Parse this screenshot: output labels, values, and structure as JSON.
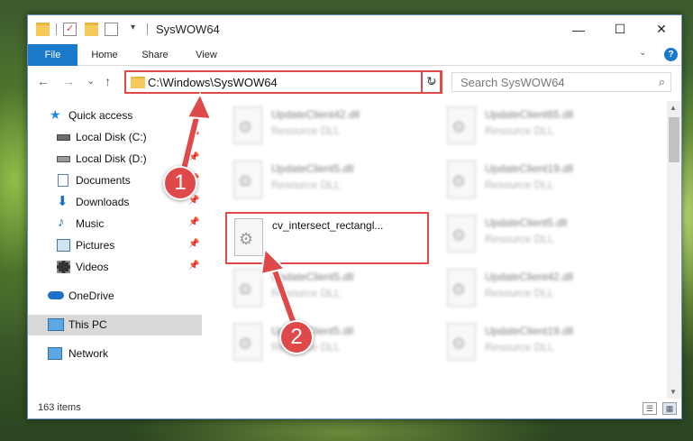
{
  "window": {
    "title": "SysWOW64",
    "minimize": "—",
    "maximize": "☐",
    "close": "✕"
  },
  "ribbon": {
    "tabs": [
      "File",
      "Home",
      "Share",
      "View"
    ],
    "help": "?"
  },
  "nav": {
    "back": "←",
    "forward": "→",
    "recent": "⌄",
    "up": "↑",
    "address": "C:\\Windows\\SysWOW64",
    "search_placeholder": "Search SysWOW64"
  },
  "sidebar": {
    "items": [
      {
        "label": "Quick access",
        "icon": "star-icon",
        "color": "#1e88e5"
      },
      {
        "label": "Local Disk (C:)",
        "icon": "drive-icon",
        "pinned": true
      },
      {
        "label": "Local Disk (D:)",
        "icon": "drive-icon",
        "pinned": true
      },
      {
        "label": "Documents",
        "icon": "document-icon",
        "pinned": true
      },
      {
        "label": "Downloads",
        "icon": "download-icon",
        "pinned": true
      },
      {
        "label": "Music",
        "icon": "music-icon",
        "pinned": true
      },
      {
        "label": "Pictures",
        "icon": "picture-icon",
        "pinned": true
      },
      {
        "label": "Videos",
        "icon": "video-icon",
        "pinned": true
      },
      {
        "label": "OneDrive",
        "icon": "cloud-icon"
      },
      {
        "label": "This PC",
        "icon": "computer-icon",
        "selected": true
      },
      {
        "label": "Network",
        "icon": "network-icon"
      }
    ]
  },
  "files": {
    "type_label": "Resource DLL",
    "col1": [
      {
        "name": "UpdateClient42.dll",
        "type": "Resource DLL"
      },
      {
        "name": "UpdateClient5.dll",
        "type": "Resource DLL"
      },
      {
        "name": "cv_intersect_rectangl...",
        "type": ""
      },
      {
        "name": "UpdateClient5.dll",
        "type": "Resource DLL"
      },
      {
        "name": "UpdateClient5.dll",
        "type": "Resource DLL"
      }
    ],
    "col2": [
      {
        "name": "UpdateClient65.dll",
        "type": "Resource DLL"
      },
      {
        "name": "UpdateClient19.dll",
        "type": "Resource DLL"
      },
      {
        "name": "UpdateClient5.dll",
        "type": "Resource DLL"
      },
      {
        "name": "UpdateClient42.dll",
        "type": "Resource DLL"
      },
      {
        "name": "UpdateClient19.dll",
        "type": "Resource DLL"
      }
    ]
  },
  "status": {
    "count": "163 items"
  },
  "annotations": {
    "step1": "1",
    "step2": "2",
    "color": "#e0494a"
  }
}
